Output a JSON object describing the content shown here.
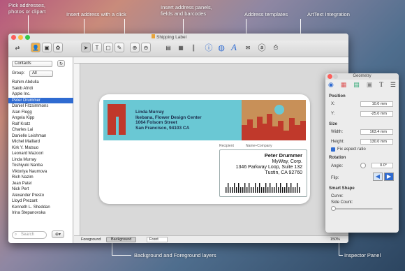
{
  "callouts": {
    "pick": [
      "Pick addresses,",
      "photos or clipart"
    ],
    "insert": "Insert address with a click",
    "panels": [
      "Insert address panels,",
      "fields and barcodes"
    ],
    "templates": "Address templates",
    "arttext": "ArtText Integration",
    "layers": "Background and Foreground layers",
    "inspector": "Inspector Panel"
  },
  "window": {
    "title": "Shipping Label"
  },
  "sidebar": {
    "source": "Contacts",
    "group_label": "Group:",
    "group_value": "All",
    "contacts": [
      "Rahim Abdulla",
      "Sakib Afridi",
      "Apple Inc.",
      "Peter Drummer",
      "Daniel Fitzsimmons",
      "Alan Flegg",
      "Angela Kipp",
      "Ralf Kratz",
      "Charles Lai",
      "Danielle Leishman",
      "Michel Maillard",
      "Kirk Y. Matsuo",
      "Leonard Mazoori",
      "Linda Murray",
      "Toshiyuki Nanba",
      "Viktoriya Naumova",
      "Rich Nazim",
      "Jean Patel",
      "Nick Pert",
      "Alexander Presto",
      "Lloyd Prezant",
      "Kenneth L. Sheddan",
      "Irina Stepanovska"
    ],
    "selected": "Peter Drummer",
    "search_placeholder": "Search"
  },
  "label": {
    "sender": [
      "Linda Murray",
      "Ikebana, Flower Design Center",
      "1064 Folsom Street",
      "San Francisco,  94103  CA"
    ],
    "field_tags": [
      "Recipient",
      "Name+Company"
    ],
    "recipient": [
      "Peter Drummer",
      "MyWay, Corp.",
      "1346 Parkway Loop, Suite 132",
      "Tustin,  CA  92760"
    ]
  },
  "statusbar": {
    "tabs": [
      "Foreground",
      "Background"
    ],
    "active": "Background",
    "layer": "Front",
    "zoom": "150%"
  },
  "inspector": {
    "title": "Geometry",
    "position_label": "Position",
    "x_label": "X:",
    "x_value": "10.0 mm",
    "y_label": "Y:",
    "y_value": "-25.0 mm",
    "size_label": "Size",
    "width_label": "Width:",
    "width_value": "163.4 mm",
    "height_label": "Height:",
    "height_value": "130.0 mm",
    "aspect_label": "Fix aspect ratio",
    "rotation_label": "Rotation",
    "angle_label": "Angle:",
    "angle_value": "0.0°",
    "flip_label": "Flip:",
    "smart_label": "Smart Shape",
    "curve_label": "Curve:",
    "sides_label": "Side Count:"
  },
  "colors": {
    "accent": "#2f6bd1",
    "band": "#6ac8d4",
    "art": "#c0392b",
    "sky": "#c89058"
  }
}
